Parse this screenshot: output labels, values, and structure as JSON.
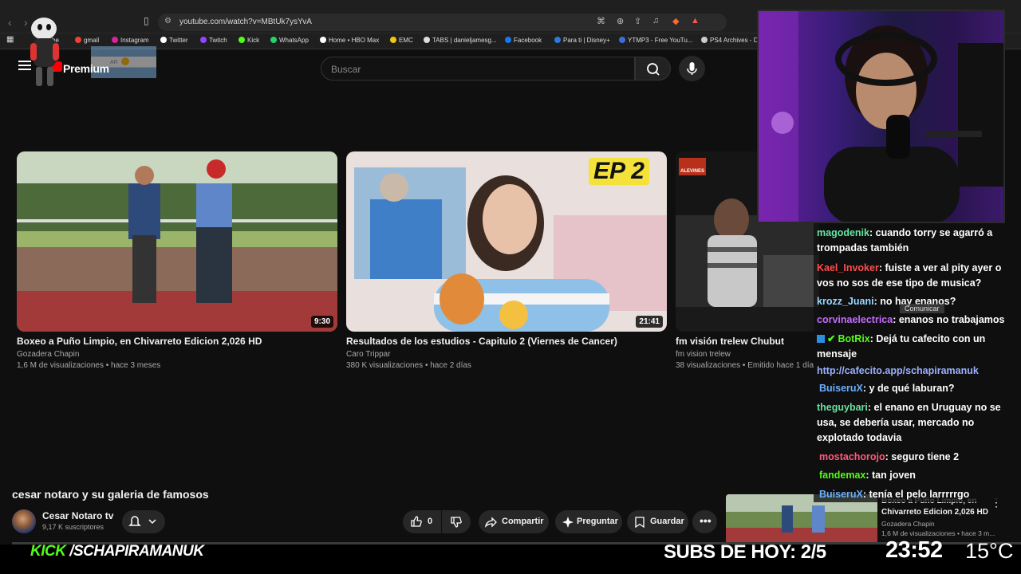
{
  "browser": {
    "url": "youtube.com/watch?v=MBtUk7ysYvA",
    "bookmarks": [
      {
        "label": "be",
        "color": "#ff0000"
      },
      {
        "label": "gmail",
        "color": "#ea4335"
      },
      {
        "label": "Instagram",
        "color": "#d6249f"
      },
      {
        "label": "Twitter",
        "color": "#ffffff"
      },
      {
        "label": "Twitch",
        "color": "#9146ff"
      },
      {
        "label": "Kick",
        "color": "#53fc18"
      },
      {
        "label": "WhatsApp",
        "color": "#25d366"
      },
      {
        "label": "Home • HBO Max",
        "color": "#ffffff"
      },
      {
        "label": "EMC",
        "color": "#f0c419"
      },
      {
        "label": "TABS | danieljamesg...",
        "color": "#dddddd"
      },
      {
        "label": "Facebook",
        "color": "#1877f2"
      },
      {
        "label": "Para ti | Disney+",
        "color": "#2b7bd8"
      },
      {
        "label": "YTMP3 - Free YouTu...",
        "color": "#3b6fd8"
      },
      {
        "label": "PS4 Archives - D",
        "color": "#cccccc"
      }
    ]
  },
  "youtube": {
    "premium_label": "Premium",
    "flag_label": "AR",
    "search_placeholder": "Buscar",
    "videos": [
      {
        "title": "Boxeo a Puño Limpio, en Chivarreto Edicion 2,026 HD",
        "channel": "Gozadera Chapin",
        "meta": "1,6 M de visualizaciones • hace 3 meses",
        "duration": "9:30"
      },
      {
        "title": "Resultados de los estudios - Capitulo 2 (Viernes de Cancer)",
        "channel": "Caro Trippar",
        "meta": "380 K visualizaciones • hace 2 días",
        "duration": "21:41",
        "badge": "EP 2"
      },
      {
        "title": "fm visión trelew Chubut",
        "channel": "fm vision trelew",
        "meta": "38 visualizaciones • Emitido hace 1 día",
        "logo": "ALEVINES"
      }
    ],
    "current": {
      "title": "cesar notaro y su galeria de famosos",
      "channel": "Cesar Notaro tv",
      "subscribers": "9,17 K suscriptores",
      "likes": "0",
      "share": "Compartir",
      "ask": "Preguntar",
      "save": "Guardar"
    },
    "mini": {
      "title": "Boxeo a Puño Limpio, en Chivarreto Edicion 2,026 HD",
      "channel": "Gozadera Chapin",
      "meta": "1,6 M de visualizaciones • hace 3 m..."
    }
  },
  "chat": [
    {
      "user": "magodenik",
      "color": "#63e6a4",
      "text": ": cuando torry se agarró a trompadas también"
    },
    {
      "user": "Kael_Invoker",
      "color": "#ff4d4d",
      "text": ": fuiste a ver al pity ayer o vos no sos de ese tipo de musica?"
    },
    {
      "user": "krozz_Juani",
      "color": "#9ad8ff",
      "text": ": no hay enanos?"
    },
    {
      "user": "corvinaelectrica",
      "color": "#c46bff",
      "text": ": enanos no trabajamos"
    },
    {
      "user": "BotRix",
      "color": "#53fc18",
      "text": ": Dejá tu cafecito con un mensaje"
    },
    {
      "user": "",
      "color": "#9ab0ff",
      "text": "http://cafecito.app/schapiramanuk"
    },
    {
      "user": "BuiseruX",
      "color": "#6ab0ff",
      "text": ": y de qué laburan?"
    },
    {
      "user": "theguybari",
      "color": "#6ae0a0",
      "text": ": el enano en Uruguay no se usa, se debería usar, mercado no explotado todavia"
    },
    {
      "user": "mostachorojo",
      "color": "#ff5a7a",
      "text": ": seguro tiene 2"
    },
    {
      "user": "fandemax",
      "color": "#53fc18",
      "text": ": tan joven"
    },
    {
      "user": "BuiseruX",
      "color": "#6ab0ff",
      "text": ": tenía el pelo larrrrrgo"
    }
  ],
  "chat_tooltip": "Comunicar",
  "overlay": {
    "kick": "KICK",
    "channel": "/SCHAPIRAMANUK",
    "subs": "SUBS DE HOY: 2/5",
    "time": "23:52",
    "temp": "15°C"
  }
}
